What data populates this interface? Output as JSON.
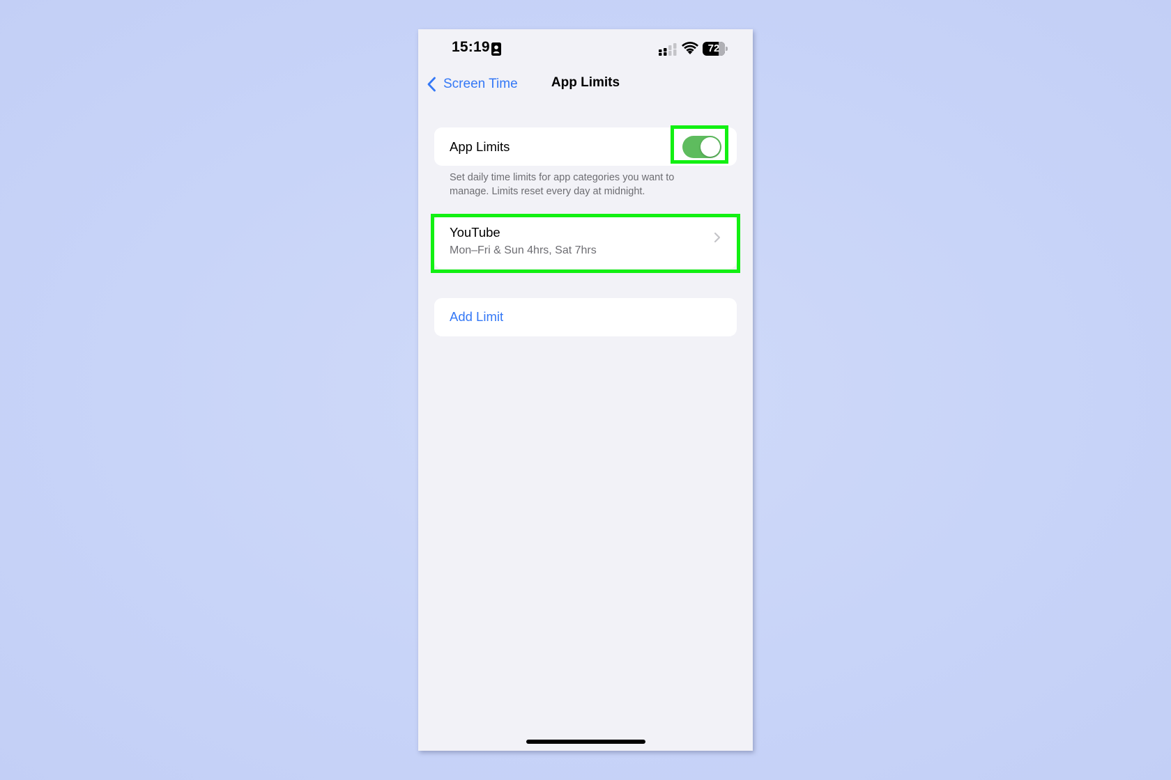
{
  "status_bar": {
    "time": "15:19",
    "battery_level": 72,
    "battery_text": "72"
  },
  "nav": {
    "back_label": "Screen Time",
    "title": "App Limits"
  },
  "app_limits_toggle": {
    "label": "App Limits",
    "enabled": true
  },
  "footer_note": "Set daily time limits for app categories you want to manage. Limits reset every day at midnight.",
  "limits": [
    {
      "name": "YouTube",
      "schedule": "Mon–Fri & Sun 4hrs, Sat 7hrs"
    }
  ],
  "add_limit_label": "Add Limit",
  "colors": {
    "accent": "#3478f6",
    "toggle_on": "#5ebc5e",
    "highlight": "#12f012",
    "background": "#c8d4f8"
  }
}
